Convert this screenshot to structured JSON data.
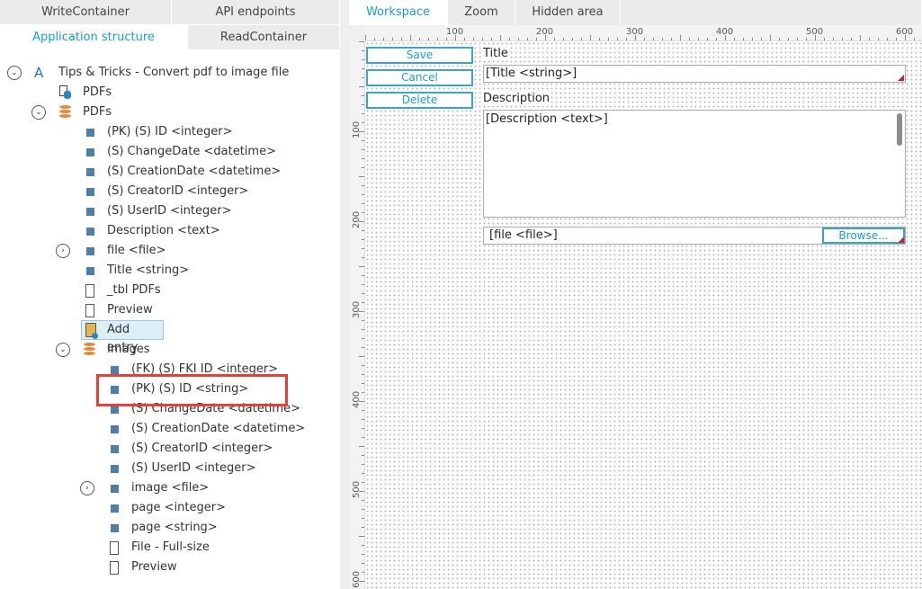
{
  "left_tabs": {
    "write_container": "WriteContainer",
    "api_endpoints": "API endpoints",
    "application_structure": "Application structure",
    "read_container": "ReadContainer"
  },
  "tree": {
    "root": "Tips & Tricks - Convert pdf to image file",
    "pdfs_link": "PDFs",
    "pdfs_table": "PDFs",
    "pdfs_fields": [
      "(PK) (S) ID <integer>",
      "(S) ChangeDate <datetime>",
      "(S) CreationDate <datetime>",
      "(S) CreatorID <integer>",
      "(S) UserID <integer>",
      "Description <text>",
      "file <file>",
      "Title <string>"
    ],
    "tbl_pdfs": "_tbl PDFs",
    "preview": "Preview",
    "add_entry": "Add entry",
    "images_table": "Images",
    "images_fields": [
      "(FK) (S) FKI ID <integer>",
      "(PK) (S) ID <string>",
      "(S) ChangeDate <datetime>",
      "(S) CreationDate <datetime>",
      "(S) CreatorID <integer>",
      "(S) UserID <integer>",
      "image <file>",
      "page <integer>",
      "page <string>"
    ],
    "file_fullsize": "File - Full-size",
    "images_preview": "Preview"
  },
  "right_tabs": {
    "workspace": "Workspace",
    "zoom": "Zoom",
    "hidden_area": "Hidden area"
  },
  "ruler": {
    "h_labels": [
      "100",
      "200",
      "300",
      "400",
      "500",
      "600"
    ],
    "v_labels": [
      "100",
      "200",
      "300",
      "400",
      "500",
      "600"
    ]
  },
  "form": {
    "save": "Save",
    "cancel": "Cancel",
    "delete": "Delete",
    "title_label": "Title",
    "title_value": "[Title <string>]",
    "description_label": "Description",
    "description_value": "[Description <text>]",
    "file_value": "[file <file>]",
    "browse": "Browse..."
  },
  "colors": {
    "accent": "#1a9fc4",
    "field_square": "#4f7fa8",
    "table_icon": "#e78a3c",
    "highlight": "#e2423a"
  }
}
